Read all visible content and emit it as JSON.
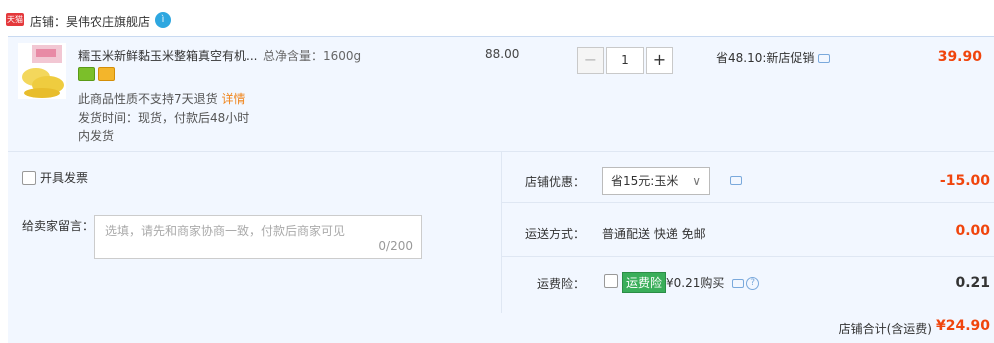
{
  "shop": {
    "badge": "天猫",
    "label": "店铺：昊伟农庄旗舰店",
    "chat_glyph": "ì"
  },
  "item": {
    "title": "糯玉米新鲜黏玉米整箱真空有机...",
    "spec": "总净含量：1600g",
    "return_note": "此商品性质不支持7天退货",
    "detail_link": "详情",
    "ship_line1": "发货时间：现货，付款后48小时",
    "ship_line2": "内发货",
    "unit_price": "88.00",
    "quantity": "1",
    "minus": "−",
    "plus": "+",
    "promo": "省48.10:新店促销",
    "total": "39.90"
  },
  "order": {
    "invoice_label": "开具发票",
    "message_label": "给卖家留言：",
    "message_placeholder": "选填，请先和商家协商一致，付款后商家可见",
    "message_count": "0/200",
    "discount_label": "店铺优惠：",
    "discount_selected": "省15元:玉米",
    "discount_amount": "-15.00",
    "shipping_label": "运送方式：",
    "shipping_value": "普通配送 快递 免邮",
    "shipping_amount": "0.00",
    "insurance_label": "运费险：",
    "insurance_tag": "运费险",
    "insurance_text": "¥0.21购买",
    "insurance_amount": "0.21"
  },
  "total": {
    "label": "店铺合计(含运费)",
    "amount": "¥24.90"
  },
  "colors": {
    "accent": "#f0450d",
    "panel": "#f2f7ff",
    "tmall": "#e4393c",
    "insurance": "#3aae5a"
  }
}
